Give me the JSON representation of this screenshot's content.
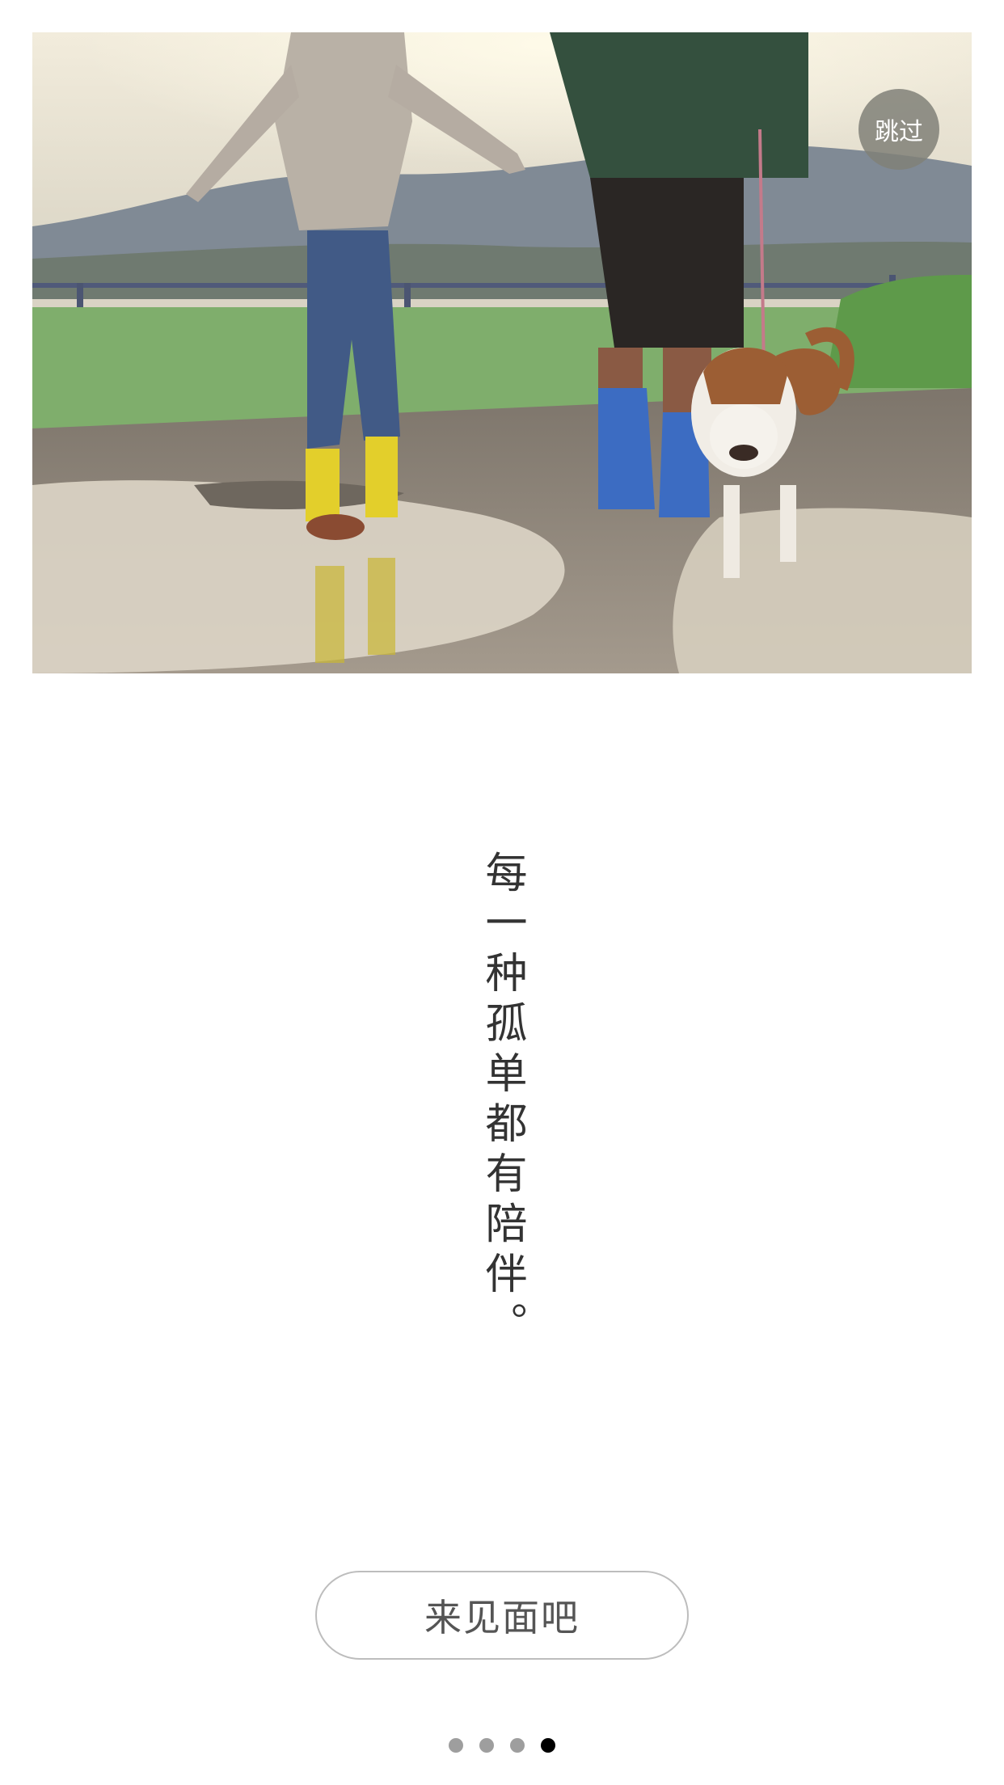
{
  "skip_button": {
    "label": "跳过"
  },
  "hero": {
    "image_description": "",
    "colors": {
      "sky": "#e9e2cf",
      "hills": "#7d8794",
      "grass": "#7aa86a",
      "road": "#8b8276",
      "puddle": "#d8d0c2"
    }
  },
  "slogan": {
    "text": "每一种孤单都有陪伴。"
  },
  "cta": {
    "label": "来见面吧"
  },
  "pagination": {
    "total": 4,
    "current": 4
  }
}
